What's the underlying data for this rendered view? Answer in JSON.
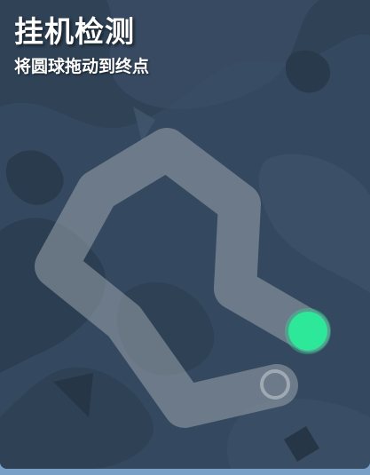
{
  "header": {
    "title": "挂机检测",
    "subtitle": "将圆球拖动到终点"
  },
  "puzzle": {
    "ball_icon": "drag-ball",
    "target_icon": "target-ring"
  },
  "colors": {
    "background": "#34495f",
    "track": "#9aa3ab",
    "ball": "#2ee89a",
    "bottom_bar": "#7aa0c8"
  }
}
